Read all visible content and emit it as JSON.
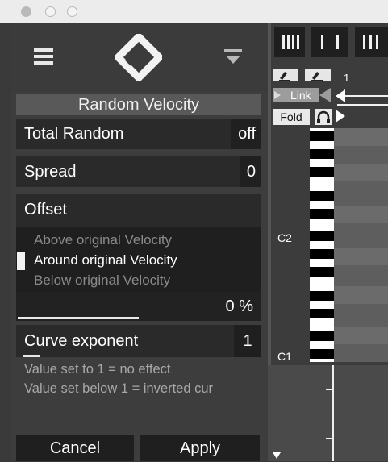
{
  "window": {
    "title": ""
  },
  "header": {
    "menu_icon": "menu-icon",
    "logo_icon": "diamond-logo-icon",
    "filter_icon": "filter-icon"
  },
  "dialog": {
    "title": "Random Velocity",
    "total_random": {
      "label": "Total Random",
      "value": "off"
    },
    "spread": {
      "label": "Spread",
      "value": "0"
    },
    "offset": {
      "label": "Offset",
      "options": [
        "Above original Velocity",
        "Around original Velocity",
        "Below original Velocity"
      ],
      "selected_index": 1,
      "value": "0 %",
      "slider_fraction": 0.5
    },
    "curve": {
      "label": "Curve exponent",
      "value": "1"
    },
    "help": [
      "Value set to 1 = no effect",
      "Value set below 1 = inverted cur"
    ],
    "cancel_label": "Cancel",
    "apply_label": "Apply"
  },
  "editor": {
    "position_label": "1",
    "link_label": "Link",
    "fold_label": "Fold",
    "note_labels": {
      "upper": "C2",
      "lower": "C1"
    },
    "colors": {
      "panel": "#3d3d3d",
      "field": "#2a2a2a",
      "accent": "#ffffff"
    }
  }
}
